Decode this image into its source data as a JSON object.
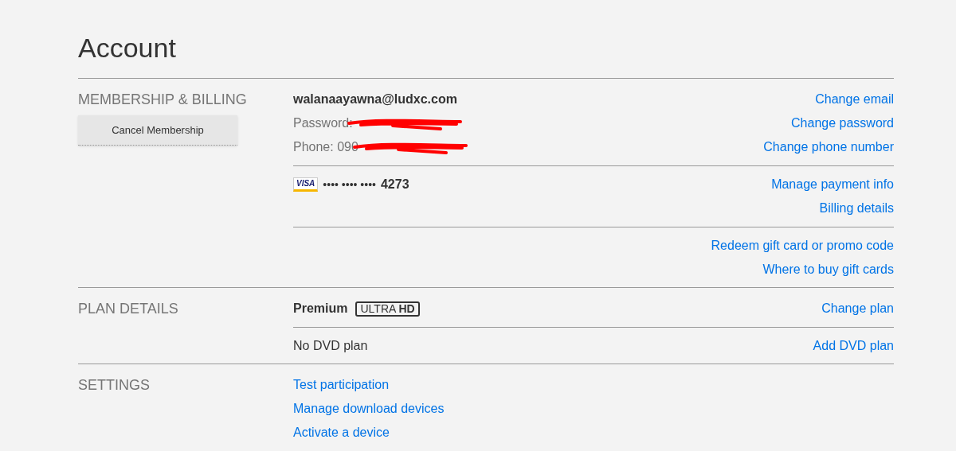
{
  "title": "Account",
  "sections": [
    {
      "heading": "MEMBERSHIP & BILLING",
      "button": "Cancel Membership",
      "groups": [
        {
          "rows": [
            {
              "kind": "email",
              "text": "walanaayawna@ludxc.com",
              "link": "Change email"
            },
            {
              "kind": "redacted",
              "text": "Password:",
              "link": "Change password"
            },
            {
              "kind": "redacted",
              "text": "Phone: 090",
              "link": "Change phone number"
            }
          ]
        },
        {
          "rows": [
            {
              "kind": "card",
              "brand": "VISA",
              "text": "•••• •••• ••••",
              "last4": "4273",
              "link": "Manage payment info"
            },
            {
              "kind": "link_only",
              "link": "Billing details"
            }
          ]
        },
        {
          "rows": [
            {
              "kind": "link_only",
              "link": "Redeem gift card or promo code"
            },
            {
              "kind": "link_only",
              "link": "Where to buy gift cards"
            }
          ]
        }
      ]
    },
    {
      "heading": "PLAN DETAILS",
      "groups": [
        {
          "rows": [
            {
              "kind": "plan",
              "text": "Premium",
              "badge": "ULTRA **HD**",
              "link": "Change plan"
            }
          ]
        },
        {
          "rows": [
            {
              "kind": "plain",
              "text": "No DVD plan",
              "link": "Add DVD plan"
            }
          ]
        }
      ]
    },
    {
      "heading": "SETTINGS",
      "groups": [
        {
          "rows": [
            {
              "kind": "setting",
              "link": "Test participation"
            },
            {
              "kind": "setting",
              "link": "Manage download devices"
            },
            {
              "kind": "setting",
              "link": "Activate a device"
            }
          ]
        }
      ]
    }
  ]
}
